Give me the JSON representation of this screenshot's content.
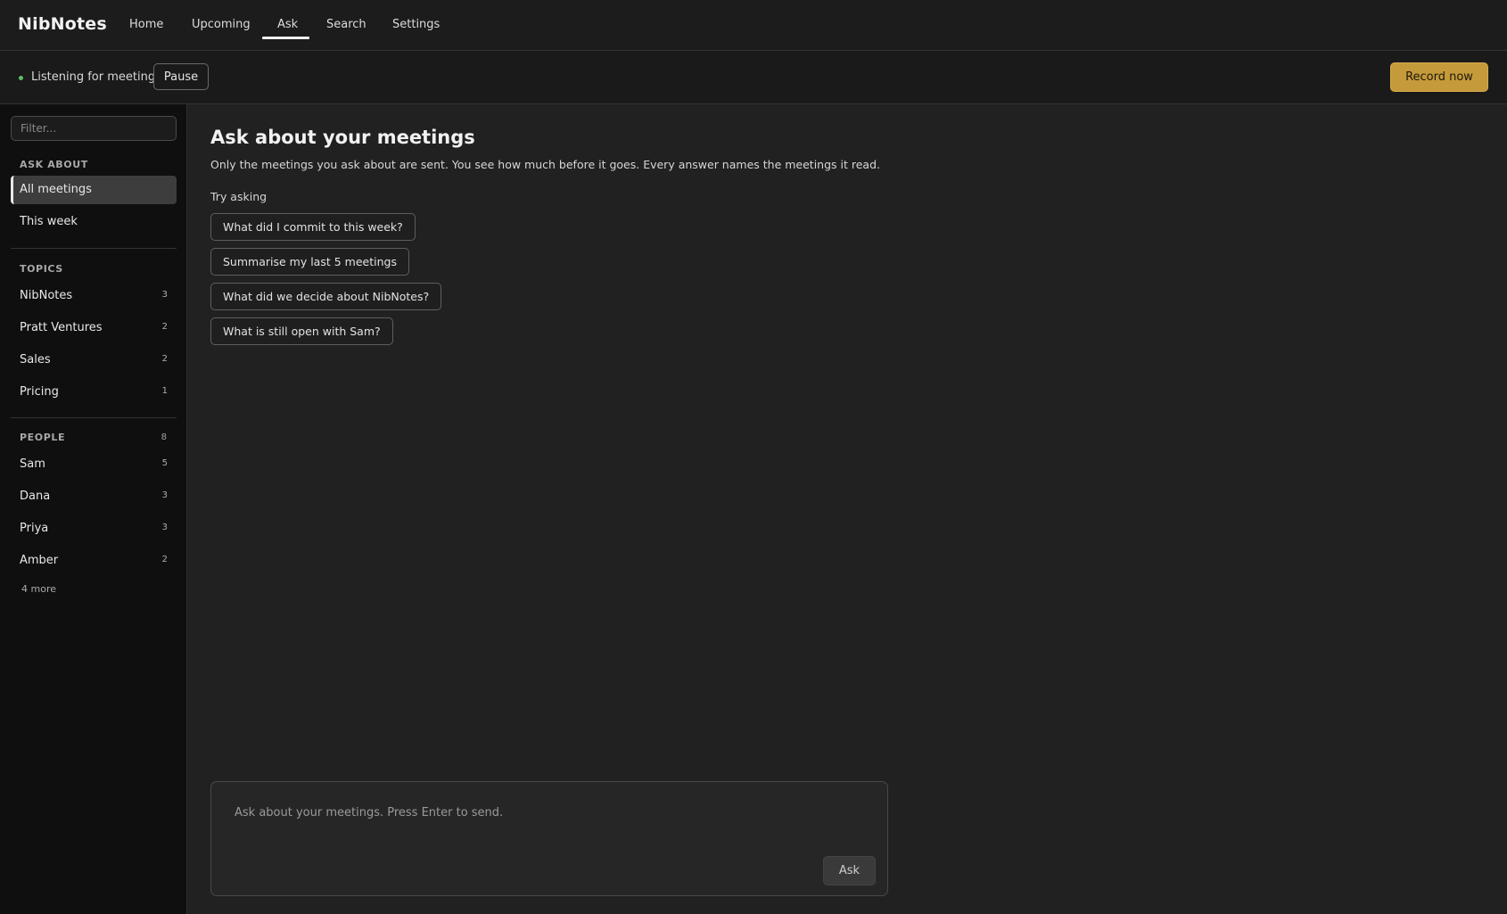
{
  "app": {
    "title": "NibNotes"
  },
  "nav": {
    "tabs": [
      {
        "label": "Home"
      },
      {
        "label": "Upcoming"
      },
      {
        "label": "Ask",
        "active": true
      },
      {
        "label": "Search"
      },
      {
        "label": "Settings"
      }
    ]
  },
  "status": {
    "text": "Listening for meetings",
    "pause_label": "Pause",
    "record_label": "Record now",
    "indicator_color": "#5bbf6a",
    "accent_color": "#c59a3a"
  },
  "sidebar": {
    "filter_placeholder": "Filter...",
    "ask_about": {
      "heading": "ASK ABOUT",
      "items": [
        {
          "label": "All meetings",
          "active": true
        },
        {
          "label": "This week"
        }
      ]
    },
    "topics": {
      "heading": "TOPICS",
      "items": [
        {
          "label": "NibNotes",
          "count": "3"
        },
        {
          "label": "Pratt Ventures",
          "count": "2"
        },
        {
          "label": "Sales",
          "count": "2"
        },
        {
          "label": "Pricing",
          "count": "1"
        }
      ]
    },
    "people": {
      "heading": "PEOPLE",
      "count": "8",
      "items": [
        {
          "label": "Sam",
          "count": "5"
        },
        {
          "label": "Dana",
          "count": "3"
        },
        {
          "label": "Priya",
          "count": "3"
        },
        {
          "label": "Amber",
          "count": "2"
        }
      ],
      "more_label": "4 more"
    }
  },
  "main": {
    "title": "Ask about your meetings",
    "subtitle": "Only the meetings you ask about are sent. You see how much before it goes. Every answer names the meetings it read.",
    "try_label": "Try asking",
    "suggestions": [
      "What did I commit to this week?",
      "Summarise my last 5 meetings",
      "What did we decide about NibNotes?",
      "What is still open with Sam?"
    ],
    "composer": {
      "placeholder": "Ask about your meetings. Press Enter to send.",
      "ask_label": "Ask"
    }
  }
}
